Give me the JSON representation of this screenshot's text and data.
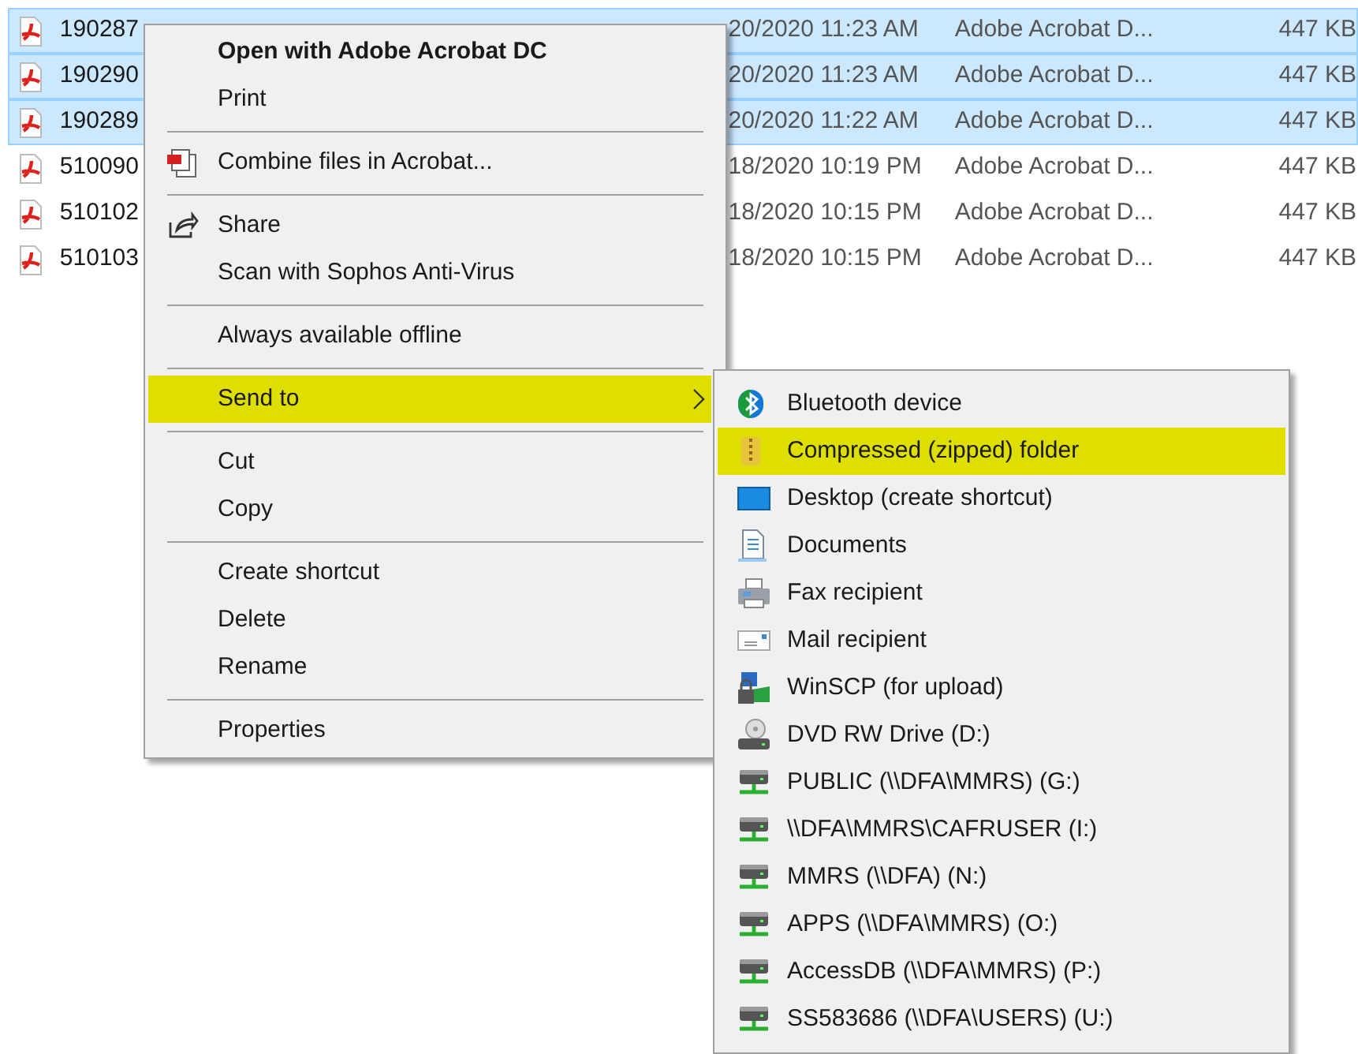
{
  "files": [
    {
      "name": "190287",
      "date": "20/2020 11:23 AM",
      "type": "Adobe Acrobat D...",
      "size": "447 KB",
      "selected": true
    },
    {
      "name": "190290",
      "date": "20/2020 11:23 AM",
      "type": "Adobe Acrobat D...",
      "size": "447 KB",
      "selected": true
    },
    {
      "name": "190289",
      "date": "20/2020 11:22 AM",
      "type": "Adobe Acrobat D...",
      "size": "447 KB",
      "selected": true
    },
    {
      "name": "510090",
      "date": "18/2020 10:19 PM",
      "type": "Adobe Acrobat D...",
      "size": "447 KB",
      "selected": false
    },
    {
      "name": "510102",
      "date": "18/2020 10:15 PM",
      "type": "Adobe Acrobat D...",
      "size": "447 KB",
      "selected": false
    },
    {
      "name": "510103",
      "date": "18/2020 10:15 PM",
      "type": "Adobe Acrobat D...",
      "size": "447 KB",
      "selected": false
    }
  ],
  "context_menu": [
    {
      "kind": "item",
      "label": "Open with Adobe Acrobat DC",
      "default": true
    },
    {
      "kind": "item",
      "label": "Print"
    },
    {
      "kind": "separator"
    },
    {
      "kind": "combine",
      "label": "Combine files in Acrobat..."
    },
    {
      "kind": "separator"
    },
    {
      "kind": "share",
      "label": "Share"
    },
    {
      "kind": "item",
      "label": "Scan with Sophos Anti-Virus"
    },
    {
      "kind": "separator"
    },
    {
      "kind": "item",
      "label": "Always available offline"
    },
    {
      "kind": "separator"
    },
    {
      "kind": "item",
      "label": "Send to",
      "submenu": true,
      "highlighted": true
    },
    {
      "kind": "separator"
    },
    {
      "kind": "item",
      "label": "Cut"
    },
    {
      "kind": "item",
      "label": "Copy"
    },
    {
      "kind": "separator"
    },
    {
      "kind": "item",
      "label": "Create shortcut"
    },
    {
      "kind": "item",
      "label": "Delete"
    },
    {
      "kind": "item",
      "label": "Rename"
    },
    {
      "kind": "separator"
    },
    {
      "kind": "item",
      "label": "Properties"
    }
  ],
  "send_to_menu": [
    {
      "kind": "bluetooth",
      "label": "Bluetooth device",
      "highlighted": false
    },
    {
      "kind": "zip",
      "label": "Compressed (zipped) folder",
      "highlighted": true
    },
    {
      "kind": "desktop",
      "label": "Desktop (create shortcut)",
      "highlighted": false
    },
    {
      "kind": "documents",
      "label": "Documents",
      "highlighted": false
    },
    {
      "kind": "fax",
      "label": "Fax recipient",
      "highlighted": false
    },
    {
      "kind": "mail",
      "label": "Mail recipient",
      "highlighted": false
    },
    {
      "kind": "winscp",
      "label": "WinSCP (for upload)",
      "highlighted": false
    },
    {
      "kind": "dvd",
      "label": "DVD RW Drive (D:)",
      "highlighted": false
    },
    {
      "kind": "network",
      "label": "PUBLIC (\\\\DFA\\MMRS) (G:)",
      "highlighted": false
    },
    {
      "kind": "network",
      "label": "\\\\DFA\\MMRS\\CAFRUSER (I:)",
      "highlighted": false
    },
    {
      "kind": "network",
      "label": "MMRS (\\\\DFA) (N:)",
      "highlighted": false
    },
    {
      "kind": "network",
      "label": "APPS (\\\\DFA\\MMRS) (O:)",
      "highlighted": false
    },
    {
      "kind": "network",
      "label": "AccessDB (\\\\DFA\\MMRS) (P:)",
      "highlighted": false
    },
    {
      "kind": "network",
      "label": "SS583686 (\\\\DFA\\USERS) (U:)",
      "highlighted": false
    }
  ]
}
